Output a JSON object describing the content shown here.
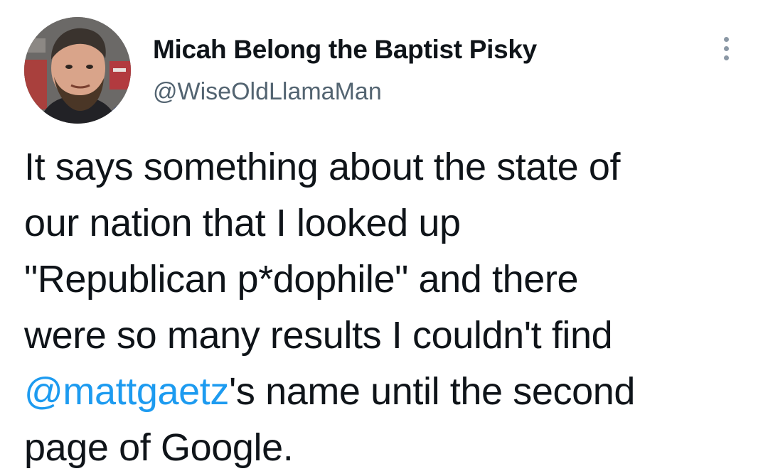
{
  "author": {
    "display_name": "Micah Belong the Baptist Pisky",
    "handle": "@WiseOldLlamaMan",
    "avatar_icon": "profile-photo"
  },
  "menu": {
    "icon": "more-options-icon"
  },
  "tweet": {
    "lines": [
      "It says something about the state of",
      "our nation that I looked up",
      "\"Republican p*dophile\" and there",
      "were so many results I couldn't find"
    ],
    "mention": "@mattgaetz",
    "mention_suffix": "'s name until the second",
    "last_line": "page of Google."
  },
  "colors": {
    "text": "#0f1419",
    "secondary": "#536471",
    "link": "#1d9bf0",
    "background": "#ffffff"
  }
}
